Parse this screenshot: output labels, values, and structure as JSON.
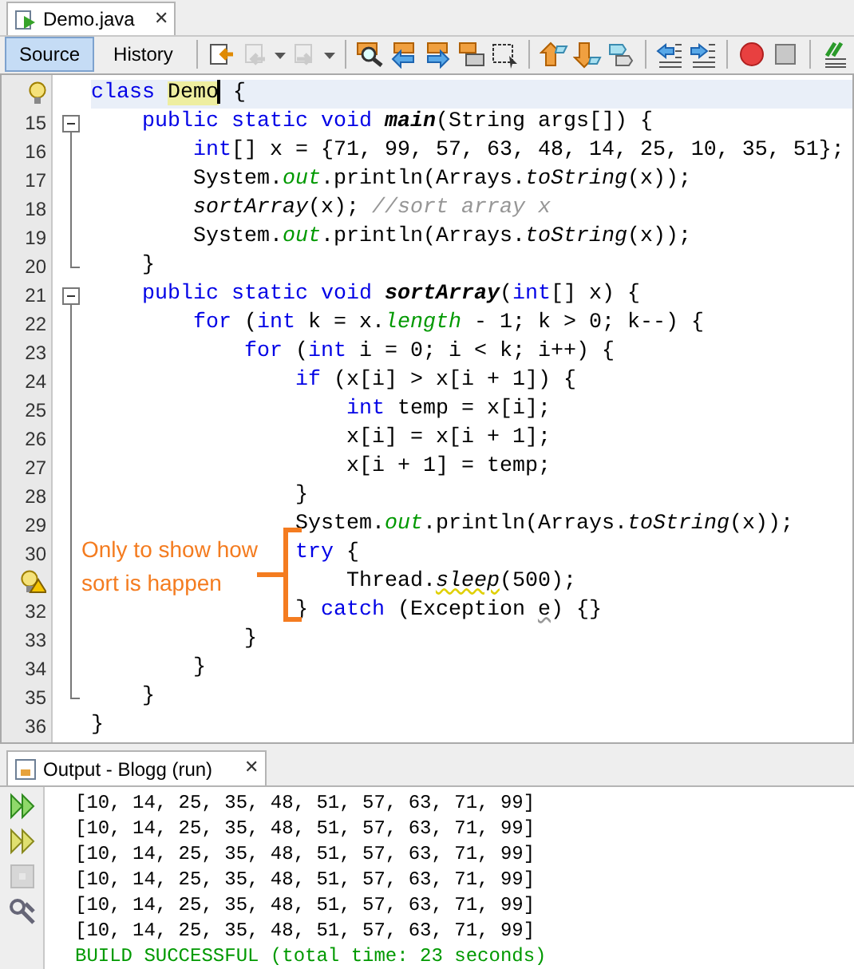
{
  "editor_tab": {
    "title": "Demo.java",
    "close": "✕"
  },
  "view_tabs": [
    {
      "label": "Source",
      "selected": true
    },
    {
      "label": "History",
      "selected": false
    }
  ],
  "toolbar": [
    {
      "kind": "last-edit",
      "disabled": false
    },
    {
      "kind": "back",
      "disabled": true
    },
    {
      "kind": "forward",
      "disabled": true
    },
    {
      "kind": "sep"
    },
    {
      "kind": "find",
      "disabled": false
    },
    {
      "kind": "find-prev",
      "disabled": false
    },
    {
      "kind": "find-next",
      "disabled": false
    },
    {
      "kind": "highlight",
      "disabled": false
    },
    {
      "kind": "rect-select",
      "disabled": false
    },
    {
      "kind": "sep"
    },
    {
      "kind": "bookmark-prev",
      "disabled": false
    },
    {
      "kind": "bookmark-next",
      "disabled": false
    },
    {
      "kind": "bookmark-toggle",
      "disabled": false
    },
    {
      "kind": "sep"
    },
    {
      "kind": "shift-left",
      "disabled": false
    },
    {
      "kind": "shift-right",
      "disabled": false
    },
    {
      "kind": "sep"
    },
    {
      "kind": "record",
      "disabled": false
    },
    {
      "kind": "stop",
      "disabled": false
    },
    {
      "kind": "sep"
    },
    {
      "kind": "comment",
      "disabled": false
    }
  ],
  "code_lines": [
    {
      "hint": true,
      "kind": "plain",
      "current": true,
      "tokens": [
        {
          "kind": "k",
          "text": "class "
        },
        {
          "kind": "h",
          "text": "Demo"
        },
        {
          "kind": "p",
          "text": " {"
        }
      ]
    },
    {
      "number": "15",
      "current": false,
      "kind": "fold-start",
      "tokens": [
        {
          "kind": "k",
          "text": "    public static void "
        },
        {
          "kind": "d",
          "text": "main"
        },
        {
          "kind": "p",
          "text": "(String args[]) {"
        }
      ]
    },
    {
      "number": "16",
      "current": false,
      "kind": "fold-body",
      "tokens": [
        {
          "kind": "k",
          "text": "        int"
        },
        {
          "kind": "p",
          "text": "[] x = {71, 99, 57, 63, 48, 14, 25, 10, 35, 51};"
        }
      ]
    },
    {
      "number": "17",
      "current": false,
      "kind": "fold-body",
      "tokens": [
        {
          "kind": "p",
          "text": "        System."
        },
        {
          "kind": "f",
          "text": "out"
        },
        {
          "kind": "p",
          "text": ".println(Arrays."
        },
        {
          "kind": "s",
          "text": "toString"
        },
        {
          "kind": "p",
          "text": "(x));"
        }
      ]
    },
    {
      "number": "18",
      "current": false,
      "kind": "fold-body",
      "tokens": [
        {
          "kind": "s",
          "text": "        sortArray"
        },
        {
          "kind": "p",
          "text": "(x); "
        },
        {
          "kind": "c",
          "text": "//sort array x"
        }
      ]
    },
    {
      "number": "19",
      "current": false,
      "kind": "fold-body",
      "tokens": [
        {
          "kind": "p",
          "text": "        System."
        },
        {
          "kind": "f",
          "text": "out"
        },
        {
          "kind": "p",
          "text": ".println(Arrays."
        },
        {
          "kind": "s",
          "text": "toString"
        },
        {
          "kind": "p",
          "text": "(x));"
        }
      ]
    },
    {
      "number": "20",
      "current": false,
      "kind": "fold-end",
      "tokens": [
        {
          "kind": "p",
          "text": "    }"
        }
      ]
    },
    {
      "number": "21",
      "current": false,
      "kind": "fold-start",
      "tokens": [
        {
          "kind": "k",
          "text": "    public static void "
        },
        {
          "kind": "d",
          "text": "sortArray"
        },
        {
          "kind": "p",
          "text": "("
        },
        {
          "kind": "k",
          "text": "int"
        },
        {
          "kind": "p",
          "text": "[] x) {"
        }
      ]
    },
    {
      "number": "22",
      "current": false,
      "kind": "fold-body",
      "tokens": [
        {
          "kind": "k",
          "text": "        for"
        },
        {
          "kind": "p",
          "text": " ("
        },
        {
          "kind": "k",
          "text": "int"
        },
        {
          "kind": "p",
          "text": " k = x."
        },
        {
          "kind": "f",
          "text": "length"
        },
        {
          "kind": "p",
          "text": " - 1; k > 0; k--) {"
        }
      ]
    },
    {
      "number": "23",
      "current": false,
      "kind": "fold-body",
      "tokens": [
        {
          "kind": "k",
          "text": "            for"
        },
        {
          "kind": "p",
          "text": " ("
        },
        {
          "kind": "k",
          "text": "int"
        },
        {
          "kind": "p",
          "text": " i = 0; i < k; i++) {"
        }
      ]
    },
    {
      "number": "24",
      "current": false,
      "kind": "fold-body",
      "tokens": [
        {
          "kind": "k",
          "text": "                if"
        },
        {
          "kind": "p",
          "text": " (x[i] > x[i + 1]) {"
        }
      ]
    },
    {
      "number": "25",
      "current": false,
      "kind": "fold-body",
      "tokens": [
        {
          "kind": "k",
          "text": "                    int"
        },
        {
          "kind": "p",
          "text": " temp = x[i];"
        }
      ]
    },
    {
      "number": "26",
      "current": false,
      "kind": "fold-body",
      "tokens": [
        {
          "kind": "p",
          "text": "                    x[i] = x[i + 1];"
        }
      ]
    },
    {
      "number": "27",
      "current": false,
      "kind": "fold-body",
      "tokens": [
        {
          "kind": "p",
          "text": "                    x[i + 1] = temp;"
        }
      ]
    },
    {
      "number": "28",
      "current": false,
      "kind": "fold-body",
      "tokens": [
        {
          "kind": "p",
          "text": "                }"
        }
      ]
    },
    {
      "number": "29",
      "current": false,
      "kind": "fold-body",
      "tokens": [
        {
          "kind": "p",
          "text": "                System."
        },
        {
          "kind": "f",
          "text": "out"
        },
        {
          "kind": "p",
          "text": ".println(Arrays."
        },
        {
          "kind": "s",
          "text": "toString"
        },
        {
          "kind": "p",
          "text": "(x));"
        }
      ]
    },
    {
      "number": "30",
      "current": false,
      "kind": "fold-body",
      "tokens": [
        {
          "kind": "k",
          "text": "                try"
        },
        {
          "kind": "p",
          "text": " {"
        }
      ]
    },
    {
      "warning": true,
      "current": false,
      "kind": "fold-body",
      "tokens": [
        {
          "kind": "p",
          "text": "                    Thread."
        },
        {
          "kind": "w",
          "text": "sleep"
        },
        {
          "kind": "p",
          "text": "(500);"
        }
      ]
    },
    {
      "number": "32",
      "current": false,
      "kind": "fold-body",
      "tokens": [
        {
          "kind": "p",
          "text": "                } "
        },
        {
          "kind": "k",
          "text": "catch"
        },
        {
          "kind": "p",
          "text": " (Exception "
        },
        {
          "kind": "u",
          "text": "e"
        },
        {
          "kind": "p",
          "text": ") {}"
        }
      ]
    },
    {
      "number": "33",
      "current": false,
      "kind": "fold-body",
      "tokens": [
        {
          "kind": "p",
          "text": "            }"
        }
      ]
    },
    {
      "number": "34",
      "current": false,
      "kind": "fold-body",
      "tokens": [
        {
          "kind": "p",
          "text": "        }"
        }
      ]
    },
    {
      "number": "35",
      "current": false,
      "kind": "fold-end",
      "tokens": [
        {
          "kind": "p",
          "text": "    }"
        }
      ]
    },
    {
      "number": "36",
      "current": false,
      "kind": "plain",
      "tokens": [
        {
          "kind": "p",
          "text": "}"
        }
      ]
    }
  ],
  "annotation": "Only to show how sort is happen",
  "output_tab": {
    "title": "Output - Blogg (run)",
    "close": "✕"
  },
  "output_actions": [
    {
      "kind": "rerun",
      "disabled": false
    },
    {
      "kind": "rerun-options",
      "disabled": false
    },
    {
      "kind": "stop",
      "disabled": true
    },
    {
      "kind": "settings",
      "disabled": false
    }
  ],
  "output_lines": [
    {
      "kind": "normal",
      "text": "[10, 14, 25, 35, 48, 51, 57, 63, 71, 99]"
    },
    {
      "kind": "normal",
      "text": "[10, 14, 25, 35, 48, 51, 57, 63, 71, 99]"
    },
    {
      "kind": "normal",
      "text": "[10, 14, 25, 35, 48, 51, 57, 63, 71, 99]"
    },
    {
      "kind": "normal",
      "text": "[10, 14, 25, 35, 48, 51, 57, 63, 71, 99]"
    },
    {
      "kind": "normal",
      "text": "[10, 14, 25, 35, 48, 51, 57, 63, 71, 99]"
    },
    {
      "kind": "normal",
      "text": "[10, 14, 25, 35, 48, 51, 57, 63, 71, 99]"
    },
    {
      "kind": "success",
      "text": "BUILD SUCCESSFUL (total time: 23 seconds)"
    }
  ]
}
